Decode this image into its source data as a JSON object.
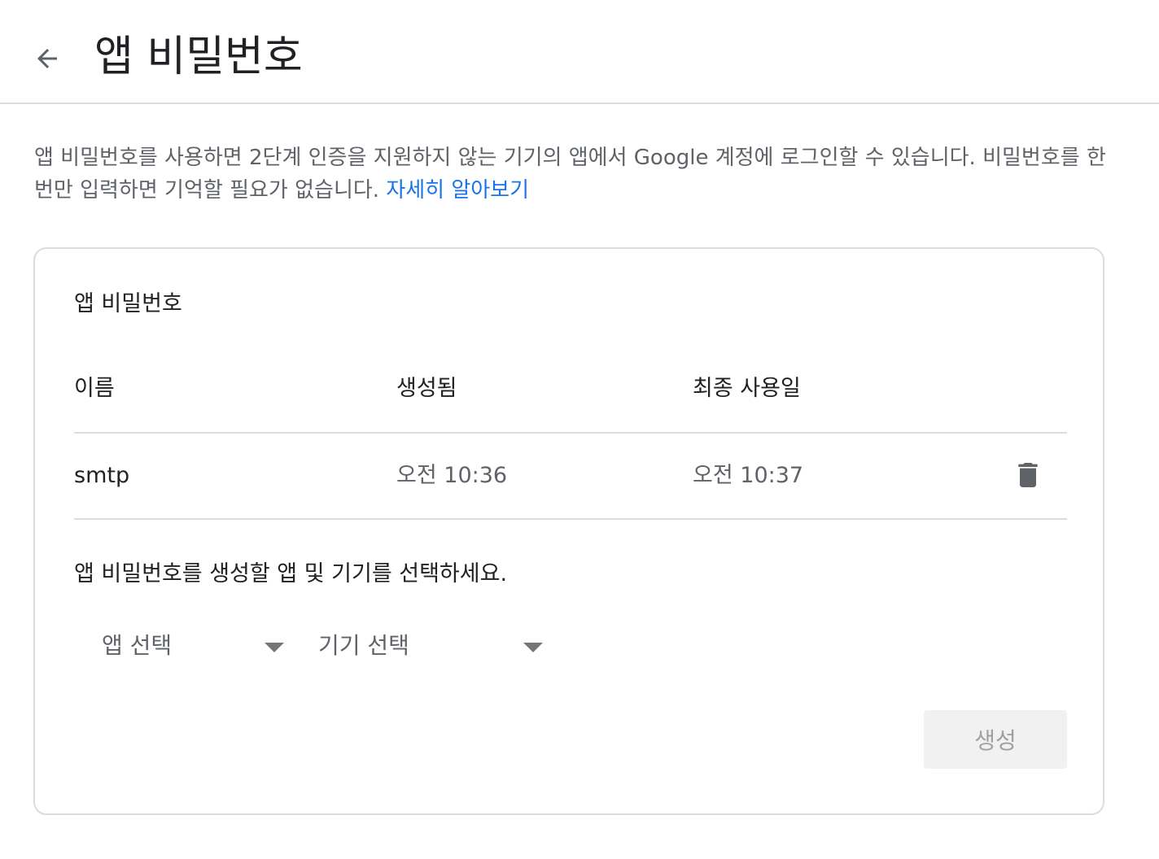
{
  "header": {
    "title": "앱 비밀번호",
    "back_icon": "arrow-back-icon"
  },
  "intro": {
    "text": "앱 비밀번호를 사용하면 2단계 인증을 지원하지 않는 기기의 앱에서 Google 계정에 로그인할 수 있습니다. 비밀번호를 한 번만 입력하면 기억할 필요가 없습니다.",
    "learn_more": "자세히 알아보기",
    "link_color": "#1a73e8"
  },
  "card": {
    "title": "앱 비밀번호",
    "columns": {
      "name": "이름",
      "created": "생성됨",
      "last_used": "최종 사용일"
    },
    "rows": [
      {
        "name": "smtp",
        "created": "오전 10:36",
        "last_used": "오전 10:37",
        "delete_icon": "trash-icon"
      }
    ],
    "select_prompt": "앱 비밀번호를 생성할 앱 및 기기를 선택하세요.",
    "app_select": {
      "label": "앱 선택",
      "icon": "dropdown-arrow-icon"
    },
    "device_select": {
      "label": "기기 선택",
      "icon": "dropdown-arrow-icon"
    },
    "generate_button": "생성"
  }
}
